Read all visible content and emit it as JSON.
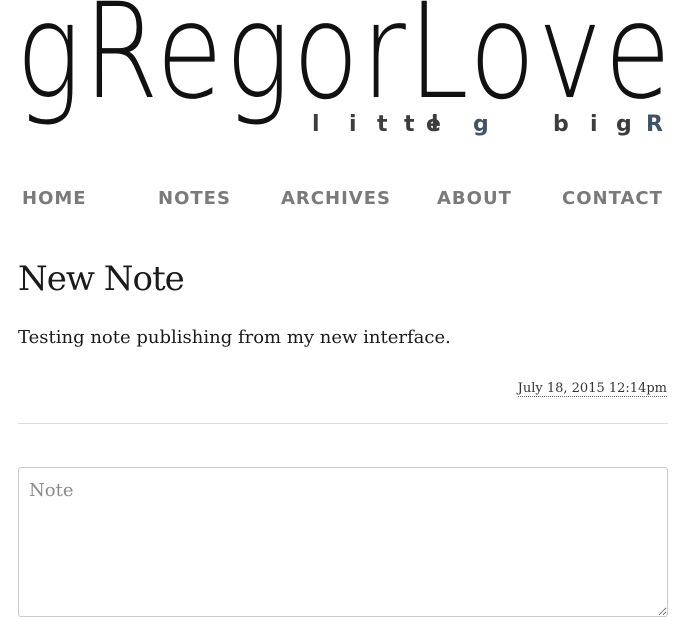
{
  "site": {
    "logo_main": "gRegorLove",
    "logo_tag_letters": [
      "l",
      "i",
      "t",
      "t",
      "l",
      "e",
      "g",
      "b",
      "i",
      "g",
      "R"
    ]
  },
  "nav": {
    "items": [
      {
        "label": "HOME"
      },
      {
        "label": "NOTES"
      },
      {
        "label": "ARCHIVES"
      },
      {
        "label": "ABOUT"
      },
      {
        "label": "CONTACT"
      }
    ]
  },
  "note": {
    "title": "New Note",
    "body": "Testing note publishing from my new interface.",
    "timestamp": "July 18, 2015 12:14pm"
  },
  "form": {
    "note_placeholder": "Note",
    "note_value": ""
  },
  "colors": {
    "nav_text": "#7a7a7a",
    "logo_accent": "#3f5468",
    "divider": "#dcdcdc"
  }
}
